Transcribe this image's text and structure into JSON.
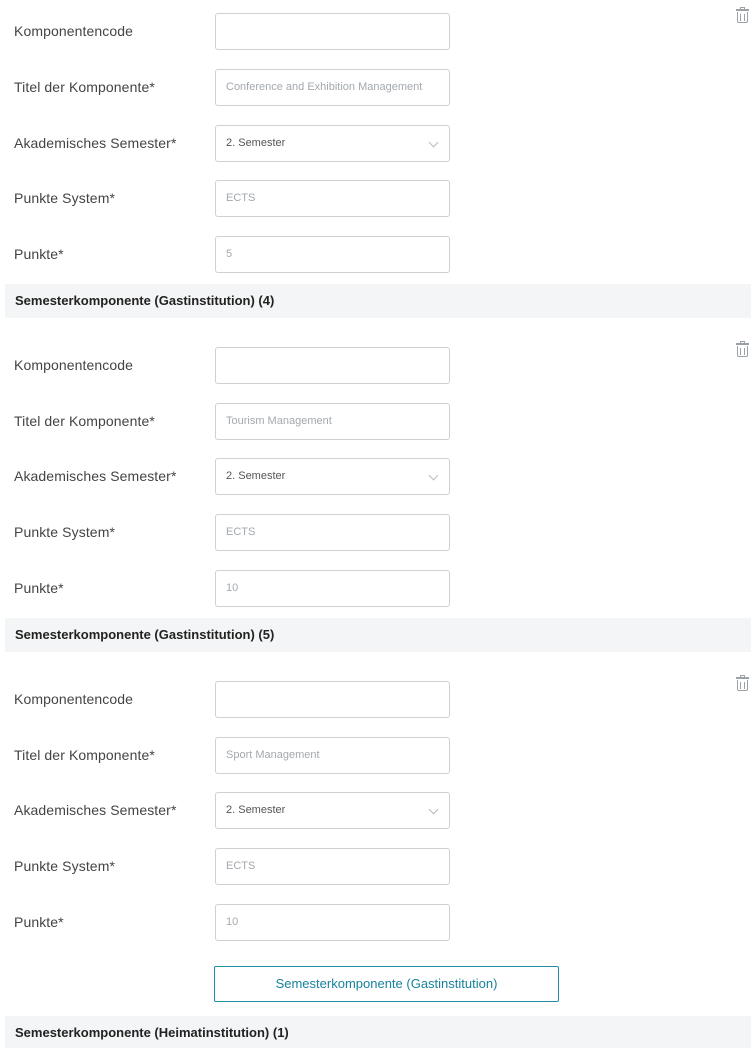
{
  "labels": {
    "code": "Komponentencode",
    "title": "Titel der Komponente*",
    "semester": "Akademisches Semester*",
    "points_system": "Punkte System*",
    "points": "Punkte*"
  },
  "blocks": [
    {
      "code": "",
      "title": "Conference and Exhibition Management",
      "semester": "2. Semester",
      "points_system": "ECTS",
      "points": "5"
    },
    {
      "code": "",
      "title": "Tourism Management",
      "semester": "2. Semester",
      "points_system": "ECTS",
      "points": "10"
    },
    {
      "code": "",
      "title": "Sport Management",
      "semester": "2. Semester",
      "points_system": "ECTS",
      "points": "10"
    }
  ],
  "sections": [
    "Semesterkomponente (Gastinstitution) (4)",
    "Semesterkomponente (Gastinstitution) (5)",
    "Semesterkomponente (Heimatinstitution) (1)"
  ],
  "add_button_label": "Semesterkomponente (Gastinstitution)",
  "icons": {
    "delete": "trash-icon",
    "dropdown": "chevron-down-icon"
  }
}
